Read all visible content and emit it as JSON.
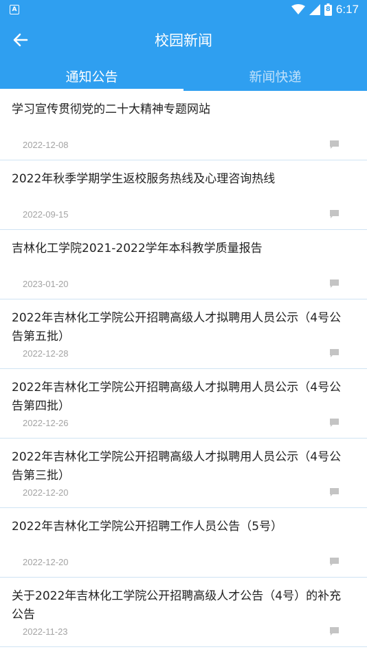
{
  "status_bar": {
    "notification_glyph": "A",
    "time": "6:17",
    "battery_glyph": "8",
    "icons": [
      "wifi-icon",
      "signal-icon",
      "battery-icon"
    ]
  },
  "app_bar": {
    "title": "校园新闻",
    "back_icon": "arrow-left-icon"
  },
  "tabs": [
    {
      "label": "通知公告",
      "active": true
    },
    {
      "label": "新闻快递",
      "active": false
    }
  ],
  "items": [
    {
      "title": "学习宣传贯彻党的二十大精神专题网站",
      "date": "2022-12-08"
    },
    {
      "title": "2022年秋季学期学生返校服务热线及心理咨询热线",
      "date": "2022-09-15"
    },
    {
      "title": "吉林化工学院2021-2022学年本科教学质量报告",
      "date": "2023-01-20"
    },
    {
      "title": "2022年吉林化工学院公开招聘高级人才拟聘用人员公示（4号公告第五批）",
      "date": "2022-12-28"
    },
    {
      "title": "2022年吉林化工学院公开招聘高级人才拟聘用人员公示（4号公告第四批）",
      "date": "2022-12-26"
    },
    {
      "title": "2022年吉林化工学院公开招聘高级人才拟聘用人员公示（4号公告第三批）",
      "date": "2022-12-20"
    },
    {
      "title": "2022年吉林化工学院公开招聘工作人员公告（5号）",
      "date": "2022-12-20"
    },
    {
      "title": "关于2022年吉林化工学院公开招聘高级人才公告（4号）的补充公告",
      "date": "2022-11-23"
    }
  ],
  "colors": {
    "primary": "#2f9ff0",
    "tab_inactive": "#bfe0fa",
    "date_text": "#a3a3a3",
    "divider": "#cfe3f3",
    "comment_icon": "#c4c4c4"
  }
}
